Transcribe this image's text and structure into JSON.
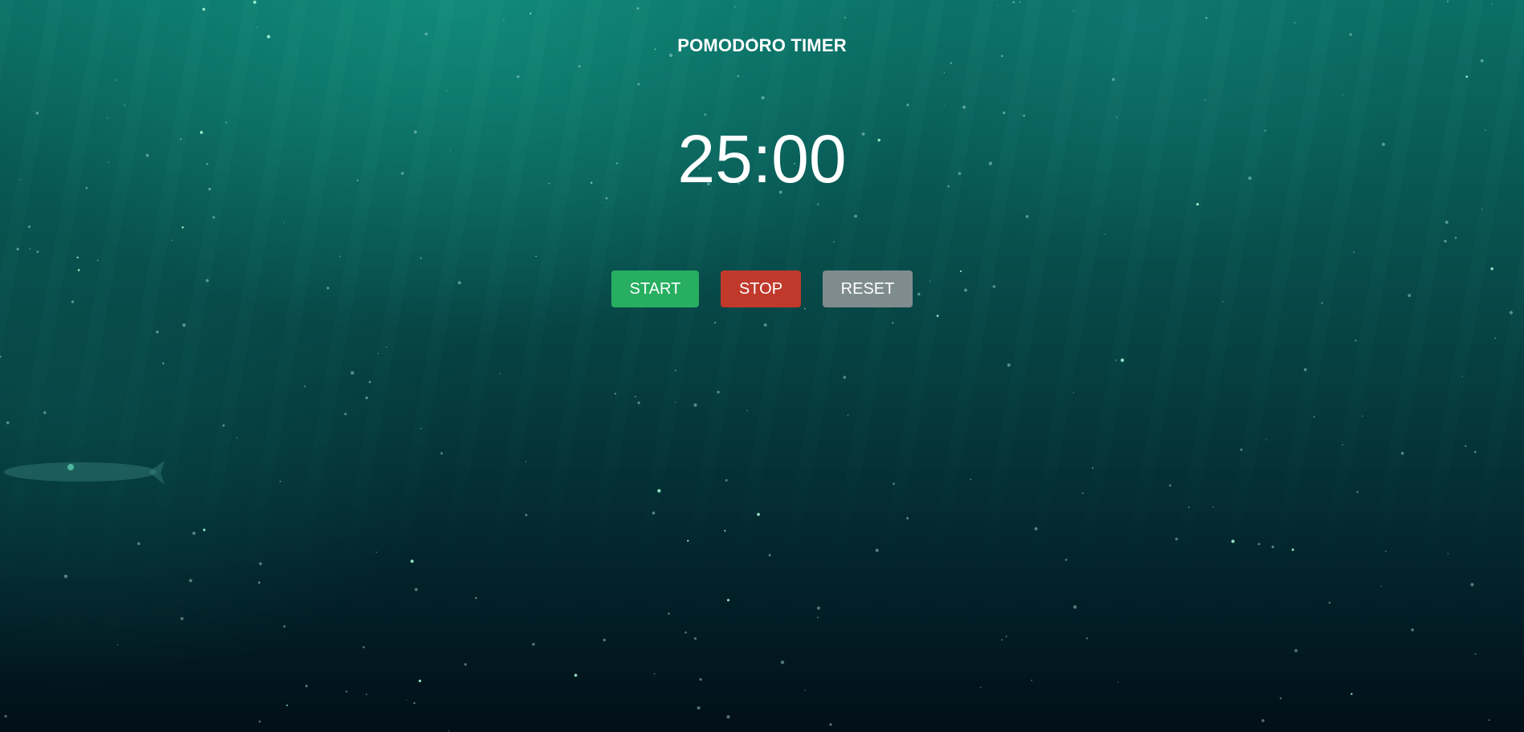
{
  "app": {
    "title": "POMODORO TIMER"
  },
  "timer": {
    "display": "25:00"
  },
  "controls": {
    "start_label": "START",
    "stop_label": "STOP",
    "reset_label": "RESET"
  },
  "colors": {
    "start": "#27ae60",
    "stop": "#c0392b",
    "reset": "#7f8c8d",
    "text": "#ffffff",
    "background_top": "#0b6f66",
    "background_bottom": "#020f18"
  }
}
